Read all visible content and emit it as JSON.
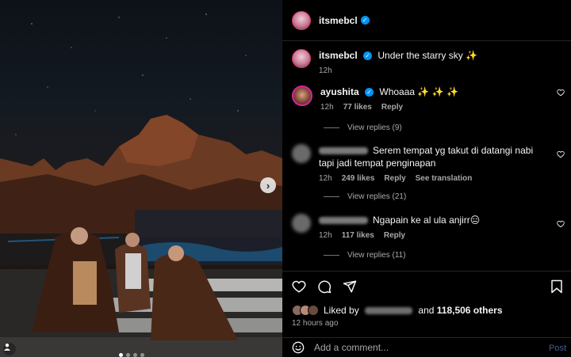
{
  "post": {
    "author": "itsmebcl",
    "verified_mark": "✓"
  },
  "caption": {
    "author": "itsmebcl",
    "text": "Under the starry sky ✨",
    "time": "12h"
  },
  "comments": [
    {
      "author": "ayushita",
      "text": "Whoaaa ✨ ✨ ✨",
      "time": "12h",
      "likes": "77 likes",
      "reply": "Reply",
      "view_replies": "View replies (9)"
    },
    {
      "author_blurred": true,
      "text": "Serem tempat yg takut di datangi nabi tapi jadi tempat penginapan",
      "time": "12h",
      "likes": "249 likes",
      "reply": "Reply",
      "translate": "See translation",
      "view_replies": "View replies (21)"
    },
    {
      "author_blurred": true,
      "text": "Ngapain ke al ula anjirr😑",
      "time": "12h",
      "likes": "117 likes",
      "reply": "Reply",
      "view_replies": "View replies (11)"
    }
  ],
  "likes": {
    "prefix": "Liked by",
    "middle": "and",
    "count": "118,506 others"
  },
  "posted_ago": "12 hours ago",
  "composer": {
    "placeholder": "Add a comment...",
    "post_label": "Post"
  },
  "icons": {
    "next": "›",
    "heart": "heart-icon",
    "comment": "comment-icon",
    "share": "share-icon",
    "bookmark": "bookmark-icon",
    "emoji": "emoji-icon"
  },
  "colors": {
    "verified": "#0095f6",
    "muted": "#a8a8a8",
    "post_link": "#4a5b8a"
  }
}
